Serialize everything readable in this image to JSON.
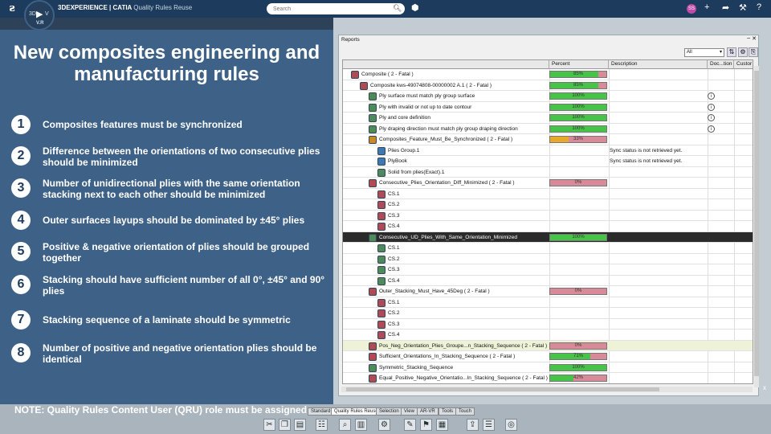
{
  "topbar": {
    "brand": "3DEXPERIENCE | CATIA",
    "app": "Quality Rules Reuse",
    "search_placeholder": "Search",
    "compass_3d": "3D",
    "compass_v": "V",
    "compass_vr": "V.R",
    "avatar": "SS"
  },
  "slide": {
    "title": "New composites engineering and manufacturing rules",
    "rules": [
      {
        "num": "1",
        "text": "Composites features must be synchronized"
      },
      {
        "num": "2",
        "text": "Difference between the orientations of two consecutive plies should be minimized"
      },
      {
        "num": "3",
        "text": "Number of unidirectional plies with the same orientation stacking next to each other should be minimized"
      },
      {
        "num": "4",
        "text": "Outer surfaces layups should be dominated by ±45° plies"
      },
      {
        "num": "5",
        "text": "Positive & negative orientation of plies should be grouped together"
      },
      {
        "num": "6",
        "text": "Stacking should have sufficient number of all 0°, ±45° and 90° plies"
      },
      {
        "num": "7",
        "text": "Stacking sequence of a laminate should be symmetric"
      },
      {
        "num": "8",
        "text": "Number of positive and negative orientation plies should be identical"
      }
    ],
    "note": "NOTE: Quality Rules Content User (QRU) role must be assigned"
  },
  "reports": {
    "title": "Reports",
    "filter": "All",
    "columns": [
      "Percent",
      "Description",
      "Doc...tion",
      "Custor"
    ],
    "rows": [
      {
        "label": "Composite ( 2 - Fatal )",
        "indent": 0,
        "icon": "red",
        "percent": 85,
        "ptext": "85%"
      },
      {
        "label": "Composite kws-49074808-00000002 A.1 ( 2 - Fatal )",
        "indent": 1,
        "icon": "red",
        "percent": 85,
        "ptext": "85%"
      },
      {
        "label": "Ply surface must match ply group surface",
        "indent": 2,
        "icon": "grn",
        "percent": 100,
        "ptext": "100%",
        "info": true
      },
      {
        "label": "Ply with invalid or not up to date contour",
        "indent": 2,
        "icon": "grn",
        "percent": 100,
        "ptext": "100%",
        "info": true
      },
      {
        "label": "Ply and core definition",
        "indent": 2,
        "icon": "grn",
        "percent": 100,
        "ptext": "100%",
        "info": true
      },
      {
        "label": "Ply draping direction must match ply group draping direction",
        "indent": 2,
        "icon": "grn",
        "percent": 100,
        "ptext": "100%",
        "info": true
      },
      {
        "label": "Composites_Feature_Must_Be_Synchronized ( 2 - Fatal )",
        "indent": 2,
        "icon": "org",
        "percent": 33,
        "ptext": "33%",
        "orange": true
      },
      {
        "label": "Plies Group.1",
        "indent": 3,
        "icon": "blu",
        "desc": "Sync status is not retrieved yet."
      },
      {
        "label": "PlyBook",
        "indent": 3,
        "icon": "blu",
        "desc": "Sync status is not retrieved yet."
      },
      {
        "label": "Solid from plies(Exact).1",
        "indent": 3,
        "icon": "grn"
      },
      {
        "label": "Consecutive_Plies_Orientation_Diff_Minimized ( 2 - Fatal )",
        "indent": 2,
        "icon": "red",
        "percent": 0,
        "ptext": "0%"
      },
      {
        "label": "CS.1",
        "indent": 3,
        "icon": "red"
      },
      {
        "label": "CS.2",
        "indent": 3,
        "icon": "red"
      },
      {
        "label": "CS.3",
        "indent": 3,
        "icon": "red"
      },
      {
        "label": "CS.4",
        "indent": 3,
        "icon": "red"
      },
      {
        "label": "Consecutive_UD_Plies_With_Same_Orientation_Minimized",
        "indent": 2,
        "icon": "grn",
        "percent": 100,
        "ptext": "100%",
        "selected": true
      },
      {
        "label": "CS.1",
        "indent": 3,
        "icon": "grn"
      },
      {
        "label": "CS.2",
        "indent": 3,
        "icon": "grn"
      },
      {
        "label": "CS.3",
        "indent": 3,
        "icon": "grn"
      },
      {
        "label": "CS.4",
        "indent": 3,
        "icon": "grn"
      },
      {
        "label": "Outer_Stacking_Must_Have_45Deg ( 2 - Fatal )",
        "indent": 2,
        "icon": "red",
        "percent": 0,
        "ptext": "0%"
      },
      {
        "label": "CS.1",
        "indent": 3,
        "icon": "red"
      },
      {
        "label": "CS.2",
        "indent": 3,
        "icon": "red"
      },
      {
        "label": "CS.3",
        "indent": 3,
        "icon": "red"
      },
      {
        "label": "CS.4",
        "indent": 3,
        "icon": "red"
      },
      {
        "label": "Pos_Neg_Orientation_Plies_Groupe...n_Stacking_Sequence ( 2 - Fatal )",
        "indent": 2,
        "icon": "red",
        "percent": 0,
        "ptext": "0%",
        "highlight": true
      },
      {
        "label": "Sufficient_Orientations_In_Stacking_Sequence ( 2 - Fatal )",
        "indent": 2,
        "icon": "red",
        "percent": 71,
        "ptext": "71%"
      },
      {
        "label": "Symmetric_Stacking_Sequence",
        "indent": 2,
        "icon": "grn",
        "percent": 100,
        "ptext": "100%"
      },
      {
        "label": "Equal_Positive_Negative_Orientatio...In_Stacking_Sequence ( 2 - Fatal )",
        "indent": 2,
        "icon": "red",
        "percent": 42,
        "ptext": "42%"
      }
    ]
  },
  "tabs": [
    "Standard",
    "Quality Rules Reuse",
    "Selection",
    "View",
    "AR-VR",
    "Tools",
    "Touch"
  ],
  "active_tab": "Quality Rules Reuse",
  "toolbar_icons": [
    "scissors-icon",
    "copy-icon",
    "paste-icon",
    "properties-icon",
    "zoom-icon",
    "book-icon",
    "settings-icon",
    "checklist-icon",
    "rule-run-icon",
    "report-icon",
    "export-icon",
    "rules-icon",
    "query-icon"
  ]
}
